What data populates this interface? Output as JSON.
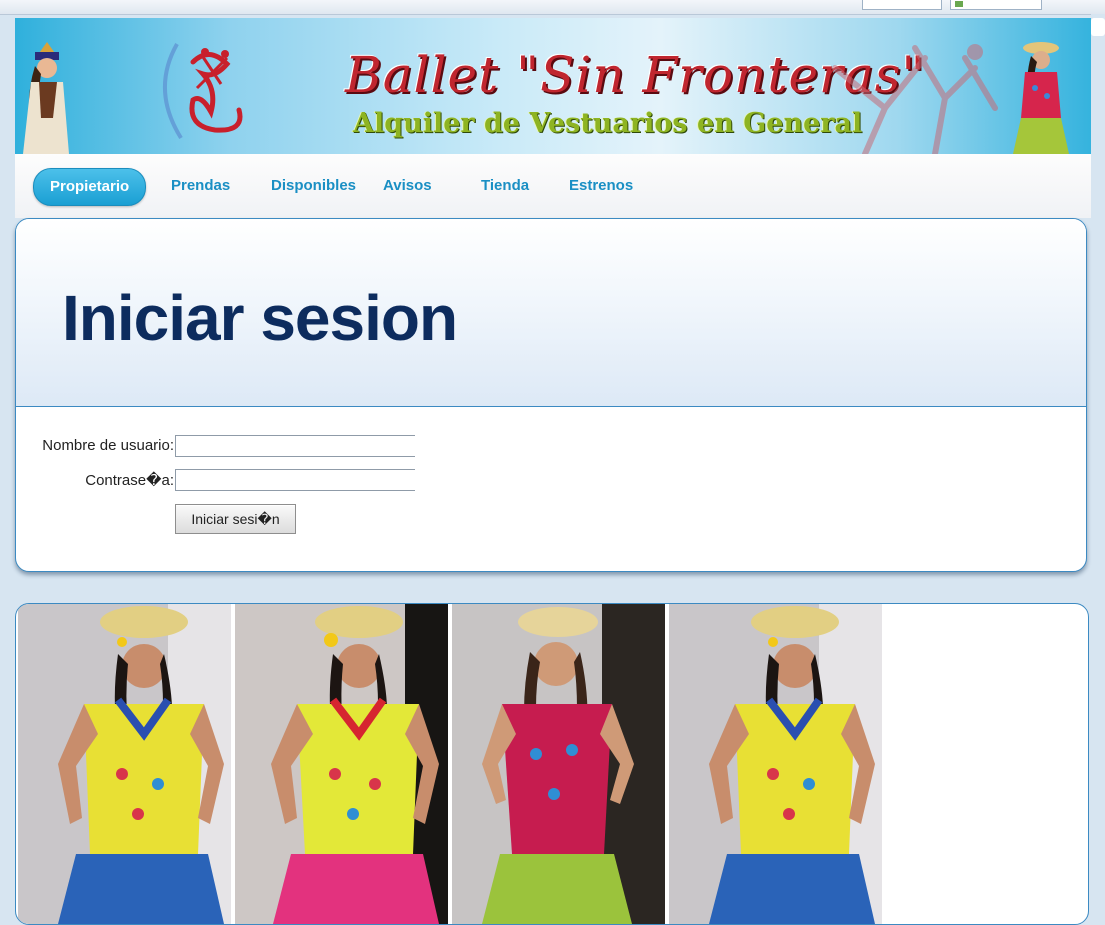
{
  "banner": {
    "title": "Ballet \"Sin Fronteras\"",
    "subtitle": "Alquiler de Vestuarios en General"
  },
  "nav": {
    "items": [
      {
        "label": "Propietario",
        "active": true
      },
      {
        "label": "Prendas",
        "active": false
      },
      {
        "label": "Disponibles",
        "active": false
      },
      {
        "label": "Avisos",
        "active": false
      },
      {
        "label": "Tienda",
        "active": false
      },
      {
        "label": "Estrenos",
        "active": false
      }
    ]
  },
  "login": {
    "heading": "Iniciar sesion",
    "username_label": "Nombre de usuario:",
    "username_value": "",
    "password_label": "Contrase�a:",
    "password_value": "",
    "submit_label": "Iniciar sesi�n"
  },
  "gallery": {
    "photos": [
      {
        "dress": "yellow-blue"
      },
      {
        "dress": "yellow-pink"
      },
      {
        "dress": "red-green"
      },
      {
        "dress": "yellow-blue"
      }
    ]
  },
  "colors": {
    "nav_text": "#1a8fc4",
    "nav_active": "#1a9fd3",
    "heading": "#0d2c5e",
    "panel_border": "#3c8ac2",
    "page_bg": "#d7e5f1"
  }
}
